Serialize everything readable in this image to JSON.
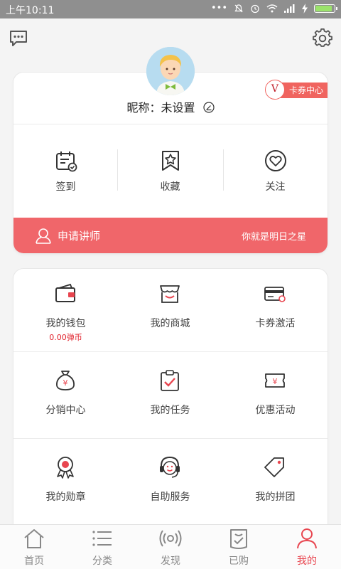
{
  "status_bar": {
    "time": "上午10:11",
    "battery_level": 0.9,
    "battery_color": "#9be36b"
  },
  "profile": {
    "nickname_label": "昵称：未设置",
    "coupon_center": {
      "letter": "V",
      "label": "卡券中心"
    }
  },
  "quick_actions": [
    {
      "label": "签到",
      "icon": "calendar-check-icon"
    },
    {
      "label": "收藏",
      "icon": "bookmark-star-icon"
    },
    {
      "label": "关注",
      "icon": "heart-circle-icon"
    }
  ],
  "lecturer_banner": {
    "label": "申请讲师",
    "slogan": "你就是明日之星",
    "color": "#f0666a"
  },
  "menu": {
    "items": [
      {
        "label": "我的钱包",
        "sub": "0.00弹币",
        "icon": "wallet-icon"
      },
      {
        "label": "我的商城",
        "icon": "shop-icon"
      },
      {
        "label": "卡券激活",
        "icon": "card-icon"
      },
      {
        "label": "分销中心",
        "icon": "money-bag-icon"
      },
      {
        "label": "我的任务",
        "icon": "task-clipboard-icon"
      },
      {
        "label": "优惠活动",
        "icon": "coupon-ticket-icon"
      },
      {
        "label": "我的勋章",
        "icon": "medal-icon"
      },
      {
        "label": "自助服务",
        "icon": "headset-icon"
      },
      {
        "label": "我的拼团",
        "icon": "tag-icon"
      }
    ]
  },
  "tabbar": {
    "tabs": [
      {
        "label": "首页",
        "icon": "home-icon"
      },
      {
        "label": "分类",
        "icon": "list-icon"
      },
      {
        "label": "发现",
        "icon": "radar-icon"
      },
      {
        "label": "已购",
        "icon": "bag-check-icon"
      },
      {
        "label": "我的",
        "icon": "person-icon",
        "active": true
      }
    ],
    "active_color": "#e8454f"
  },
  "accent_color": "#e8454f"
}
